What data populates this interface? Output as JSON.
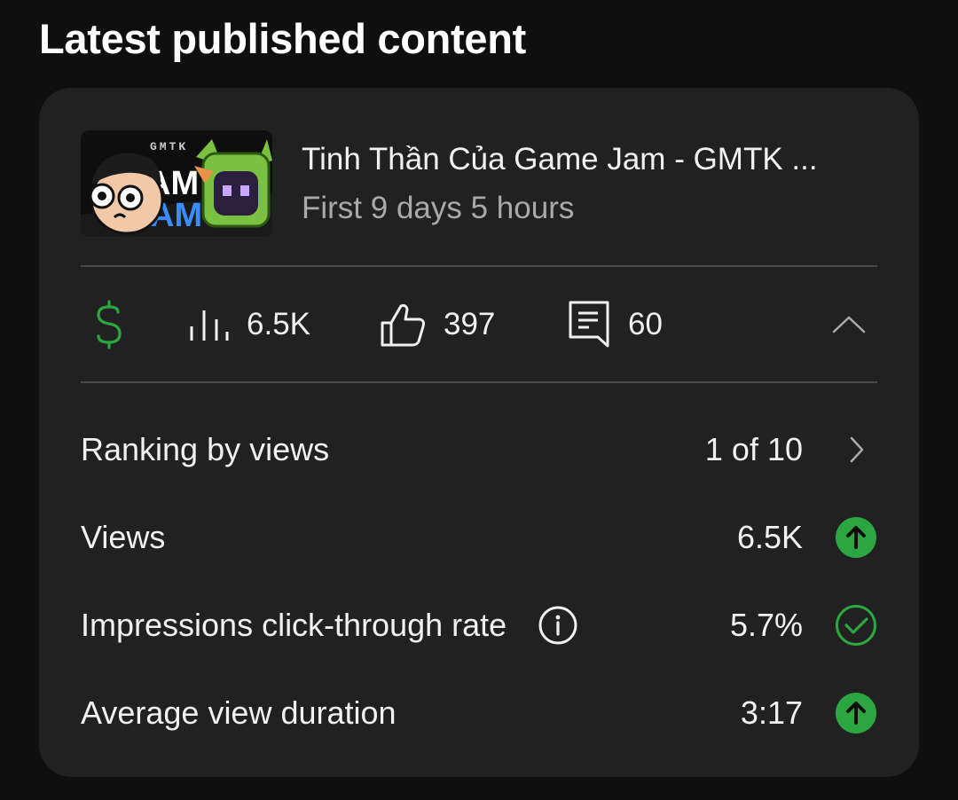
{
  "section": {
    "title": "Latest published content"
  },
  "video": {
    "title": "Tinh Thần Của Game Jam - GMTK ...",
    "subtitle": "First 9 days 5 hours",
    "thumbnail_text": "GMTK"
  },
  "stats": {
    "revenue_icon": "dollar-icon",
    "views": "6.5K",
    "likes": "397",
    "comments": "60",
    "collapse_icon": "chevron-up-icon"
  },
  "metrics": [
    {
      "label": "Ranking by views",
      "value": "1 of 10",
      "trail_icon": "chevron-right-icon"
    },
    {
      "label": "Views",
      "value": "6.5K",
      "trail_icon": "arrow-up-circle-icon"
    },
    {
      "label": "Impressions click-through rate",
      "value": "5.7%",
      "trail_icon": "check-circle-icon",
      "info_icon": "info-icon"
    },
    {
      "label": "Average view duration",
      "value": "3:17",
      "trail_icon": "arrow-up-circle-icon"
    }
  ],
  "colors": {
    "background": "#0f0f0f",
    "card": "#212121",
    "divider": "#4a4a4a",
    "text_primary": "#f1f1f1",
    "text_secondary": "#aaaaaa",
    "positive_green": "#2ba640"
  }
}
